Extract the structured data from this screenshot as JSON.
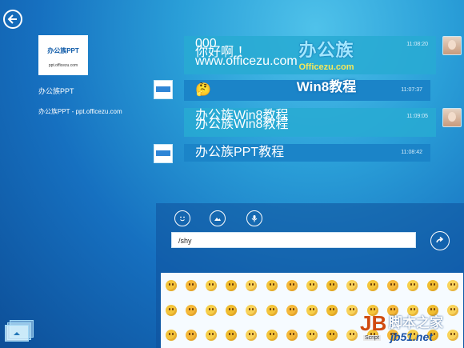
{
  "contact": {
    "logo_text": "办公族PPT",
    "logo_domain": "ppt.officezu.com",
    "name": "办公族PPT",
    "subtitle": "办公族PPT - ppt.officezu.com"
  },
  "messages": [
    {
      "lines": [
        "000",
        "你好啊 ！",
        "www.officezu.com"
      ],
      "time": "11:08:20",
      "sender": "me"
    },
    {
      "lines": [
        "🤔"
      ],
      "time": "11:07:37",
      "sender": "contact"
    },
    {
      "lines": [
        "办公族Win8教程",
        "办公族Win8教程"
      ],
      "time": "11:09:05",
      "sender": "me"
    },
    {
      "lines": [
        "办公族PPT教程"
      ],
      "time": "11:08:42",
      "sender": "contact"
    }
  ],
  "watermark": {
    "line1": "办公族",
    "line2": "Officezu.com",
    "line3": "Win8教程"
  },
  "composer": {
    "input_value": "/shy",
    "tools": [
      "smiley-icon",
      "image-icon",
      "microphone-icon"
    ]
  },
  "emoji_count": 45,
  "footer_mark": {
    "jb": "JB",
    "script": "Script",
    "site": "脚本之家",
    "url": "jb51.net"
  },
  "colors": {
    "accent": "#2a9fd1",
    "background": "#1670c0"
  }
}
